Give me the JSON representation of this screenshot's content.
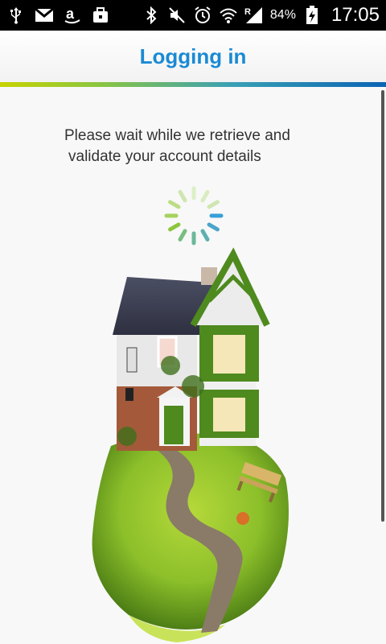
{
  "status_bar": {
    "battery_percent": "84%",
    "time": "17:05",
    "icons": [
      "usb-icon",
      "gmail-icon",
      "amazon-icon",
      "briefcase-icon",
      "bluetooth-icon",
      "mute-icon",
      "alarm-icon",
      "wifi-icon",
      "signal-icon",
      "battery-charging-icon"
    ]
  },
  "header": {
    "title": "Logging in"
  },
  "main": {
    "message_line1": "Please wait while we retrieve and",
    "message_line2": "validate your account details"
  },
  "colors": {
    "title": "#1a8ad4",
    "spinner_active": "#3a9fd8",
    "spinner_green": "#8cc63e"
  }
}
